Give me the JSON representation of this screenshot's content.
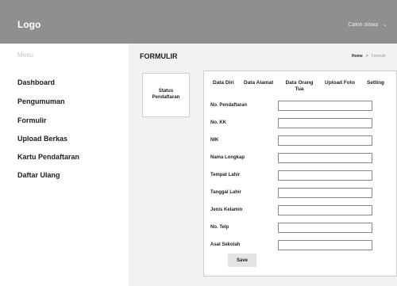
{
  "header": {
    "logo": "Logo",
    "user_label": "Calon siswa"
  },
  "sidebar": {
    "heading": "Menu",
    "items": [
      {
        "label": "Dashboard"
      },
      {
        "label": "Pengumuman"
      },
      {
        "label": "Formulir"
      },
      {
        "label": "Upload Berkas"
      },
      {
        "label": "Kartu Pendaftaran"
      },
      {
        "label": "Daftar Ulang"
      }
    ]
  },
  "main": {
    "title": "FORMULIR",
    "breadcrumb": {
      "home": "Home",
      "separator": ">",
      "current": "Formulir"
    },
    "status_card": {
      "label": "Status Pendaftaran"
    },
    "tabs": [
      {
        "label": "Data Diri"
      },
      {
        "label": "Data Alamat"
      },
      {
        "label": "Data Orang Tua"
      },
      {
        "label": "Upload Foto"
      },
      {
        "label": "Setting"
      }
    ],
    "fields": [
      {
        "label": "No. Pendaftaran",
        "value": ""
      },
      {
        "label": "No. KK",
        "value": ""
      },
      {
        "label": "NIK",
        "value": ""
      },
      {
        "label": "Nama Longkap",
        "value": ""
      },
      {
        "label": "Tempat Lahir",
        "value": ""
      },
      {
        "label": "Tanggal Lahir",
        "value": ""
      },
      {
        "label": "Jenis Kelamin",
        "value": ""
      },
      {
        "label": "No. Telp",
        "value": ""
      },
      {
        "label": "Asal Sekolah",
        "value": ""
      }
    ],
    "save_label": "Save"
  }
}
